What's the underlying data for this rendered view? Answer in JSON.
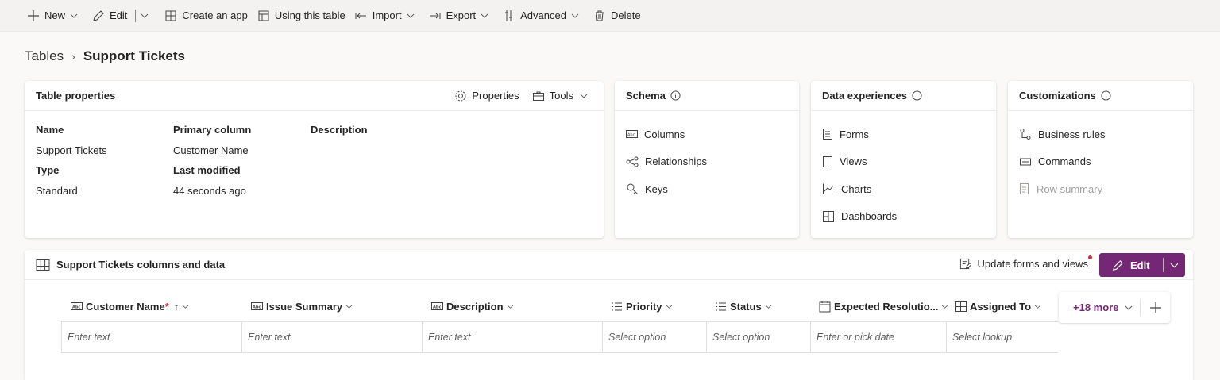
{
  "toolbar": {
    "new": "New",
    "edit": "Edit",
    "create_app": "Create an app",
    "using_table": "Using this table",
    "import": "Import",
    "export": "Export",
    "advanced": "Advanced",
    "delete": "Delete"
  },
  "breadcrumb": {
    "root": "Tables",
    "current": "Support Tickets"
  },
  "table_properties": {
    "title": "Table properties",
    "properties_btn": "Properties",
    "tools_btn": "Tools",
    "name_label": "Name",
    "name_value": "Support Tickets",
    "type_label": "Type",
    "type_value": "Standard",
    "primary_label": "Primary column",
    "primary_value": "Customer Name",
    "modified_label": "Last modified",
    "modified_value": "44 seconds ago",
    "description_label": "Description"
  },
  "schema": {
    "title": "Schema",
    "items": [
      "Columns",
      "Relationships",
      "Keys"
    ]
  },
  "data_experiences": {
    "title": "Data experiences",
    "items": [
      "Forms",
      "Views",
      "Charts",
      "Dashboards"
    ]
  },
  "customizations": {
    "title": "Customizations",
    "items": [
      "Business rules",
      "Commands",
      "Row summary"
    ]
  },
  "data_section": {
    "title": "Support Tickets columns and data",
    "update_btn": "Update forms and views",
    "edit_btn": "Edit",
    "more_btn": "+18 more",
    "columns": [
      {
        "label": "Customer Name",
        "required": "*",
        "placeholder": "Enter text"
      },
      {
        "label": "Issue Summary",
        "placeholder": "Enter text"
      },
      {
        "label": "Description",
        "placeholder": "Enter text"
      },
      {
        "label": "Priority",
        "placeholder": "Select option"
      },
      {
        "label": "Status",
        "placeholder": "Select option"
      },
      {
        "label": "Expected Resolutio...",
        "placeholder": "Enter or pick date"
      },
      {
        "label": "Assigned To",
        "placeholder": "Select lookup"
      }
    ]
  },
  "colors": {
    "accent": "#742774",
    "required": "#c4314b"
  }
}
